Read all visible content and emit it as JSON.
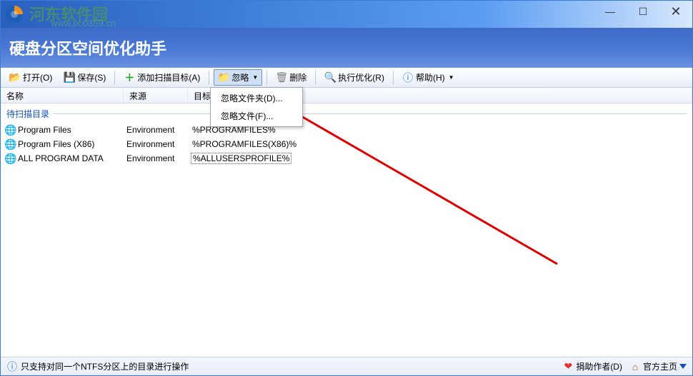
{
  "watermark": {
    "text": "河东软件园",
    "url": "www.pc0359.cn"
  },
  "app": {
    "title": "硬盘分区空间优化助手"
  },
  "toolbar": {
    "open": "打开(O)",
    "save": "保存(S)",
    "add": "添加扫描目标(A)",
    "ignore": "忽略",
    "delete": "删除",
    "run": "执行优化(R)",
    "help": "帮助(H)"
  },
  "columns": {
    "name": "名称",
    "source": "来源",
    "path": "目标路"
  },
  "group": {
    "label": "待扫描目录"
  },
  "rows": [
    {
      "name": "Program Files",
      "source": "Environment",
      "path": "%PROGRAMFILES%"
    },
    {
      "name": "Program Files (X86)",
      "source": "Environment",
      "path": "%PROGRAMFILES(X86)%"
    },
    {
      "name": "ALL PROGRAM DATA",
      "source": "Environment",
      "path": "%ALLUSERSPROFILE%"
    }
  ],
  "menu": {
    "ignoreFolder": "忽略文件夹(D)...",
    "ignoreFile": "忽略文件(F)..."
  },
  "status": {
    "hint": "只支持对同一个NTFS分区上的目录进行操作",
    "donate": "捐助作者(D)",
    "homepage": "官方主页"
  }
}
